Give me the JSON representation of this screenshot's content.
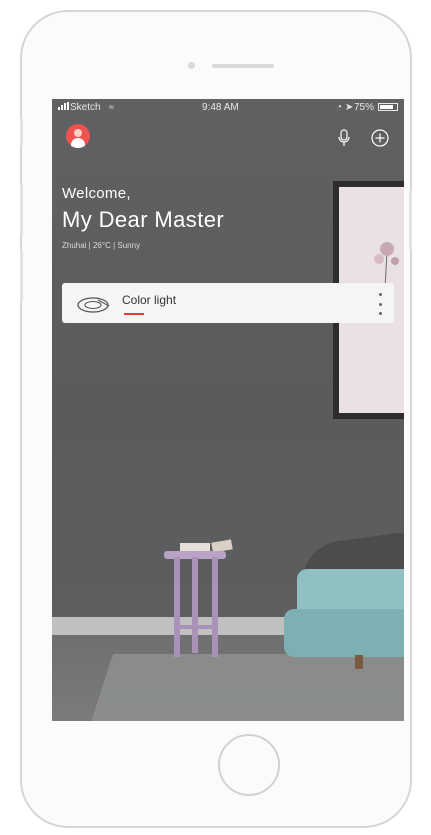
{
  "status_bar": {
    "carrier": "Sketch",
    "time": "9:48 AM",
    "battery_percent": "75%",
    "battery_level": 0.75
  },
  "header": {
    "greeting": "Welcome,",
    "title": "My Dear Master",
    "weather": "Zhuhai | 26°C | Sunny"
  },
  "device_card": {
    "label": "Color light",
    "icon": "light-strip-icon"
  },
  "icons": {
    "avatar": "user-avatar-icon",
    "voice": "microphone-icon",
    "add": "plus-circle-icon",
    "more": "more-vertical-icon"
  },
  "colors": {
    "accent": "#e53935",
    "avatar_bg": "#ef5350",
    "card_bg": "#f5f5f5",
    "wall": "#5d5f60"
  }
}
